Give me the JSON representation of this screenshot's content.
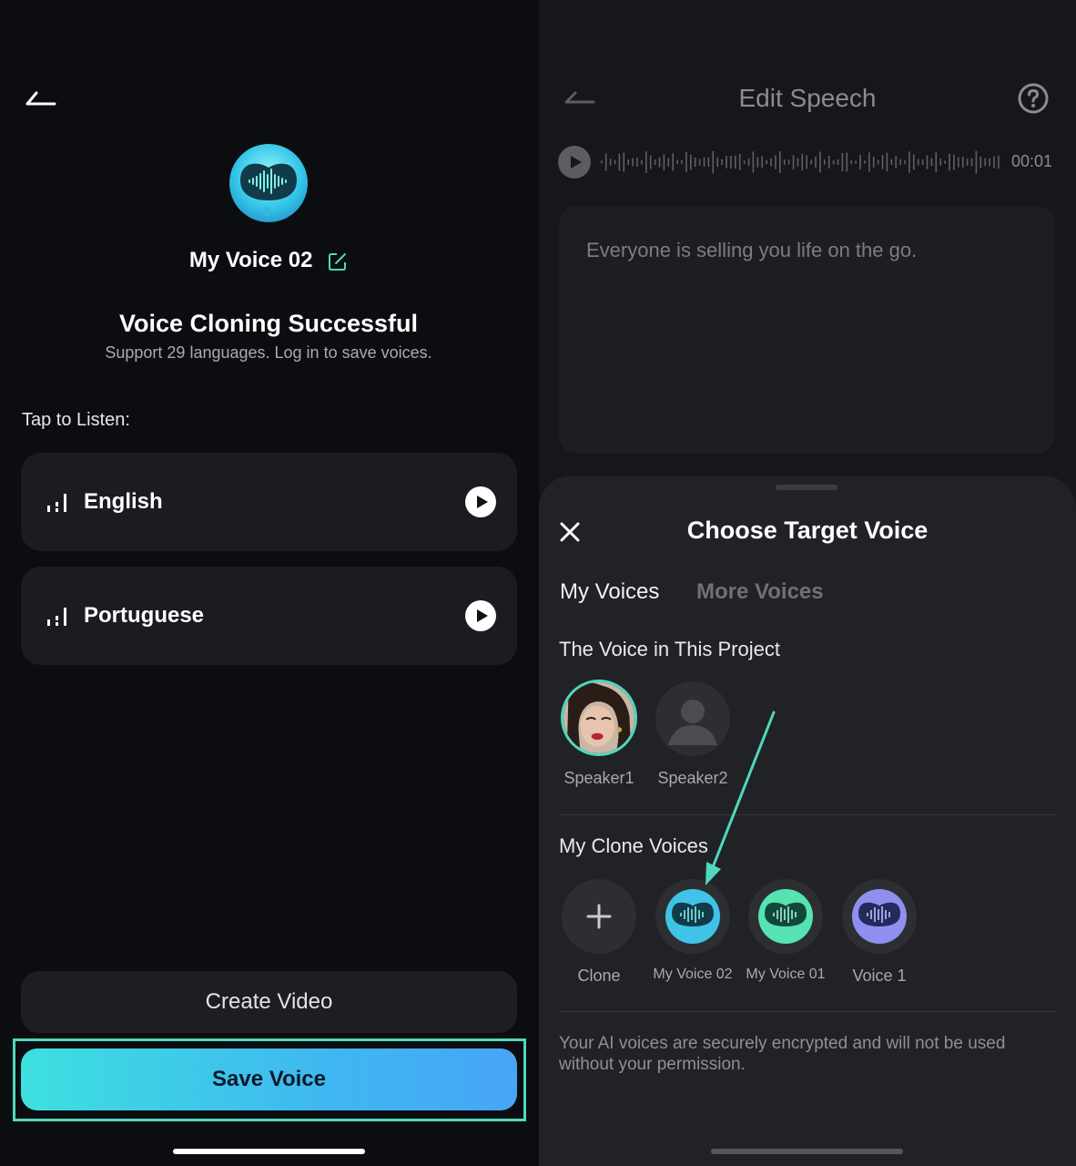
{
  "left": {
    "voice_name": "My Voice 02",
    "title": "Voice Cloning Successful",
    "subtitle": "Support 29 languages. Log in to save voices.",
    "tap_label": "Tap to Listen:",
    "languages": [
      {
        "label": "English"
      },
      {
        "label": "Portuguese"
      }
    ],
    "create_video_label": "Create Video",
    "save_voice_label": "Save Voice"
  },
  "right": {
    "header_title": "Edit Speech",
    "audio_time": "00:01",
    "speech_text": "Everyone is selling you life on the go.",
    "sheet": {
      "title": "Choose Target Voice",
      "tabs": [
        {
          "label": "My Voices",
          "active": true
        },
        {
          "label": "More Voices",
          "active": false
        }
      ],
      "project_section_label": "The Voice in This Project",
      "speakers": [
        {
          "label": "Speaker1",
          "selected": true
        },
        {
          "label": "Speaker2",
          "selected": false
        }
      ],
      "clone_section_label": "My Clone Voices",
      "clone_voices": [
        {
          "label": "Clone",
          "icon": "plus-icon"
        },
        {
          "label": "My Voice 02",
          "icon": "voice-orb-icon"
        },
        {
          "label": "My Voice 01",
          "icon": "voice-orb-icon"
        },
        {
          "label": "Voice 1",
          "icon": "voice-orb-icon"
        }
      ],
      "privacy_note": "Your AI voices are securely encrypted and will not be used without your permission."
    }
  },
  "colors": {
    "accent_teal": "#4fd8bd",
    "save_gradient_start": "#3ee0e0",
    "save_gradient_end": "#47a5f7",
    "background": "#0b0d10",
    "sheet_background": "#202226"
  }
}
